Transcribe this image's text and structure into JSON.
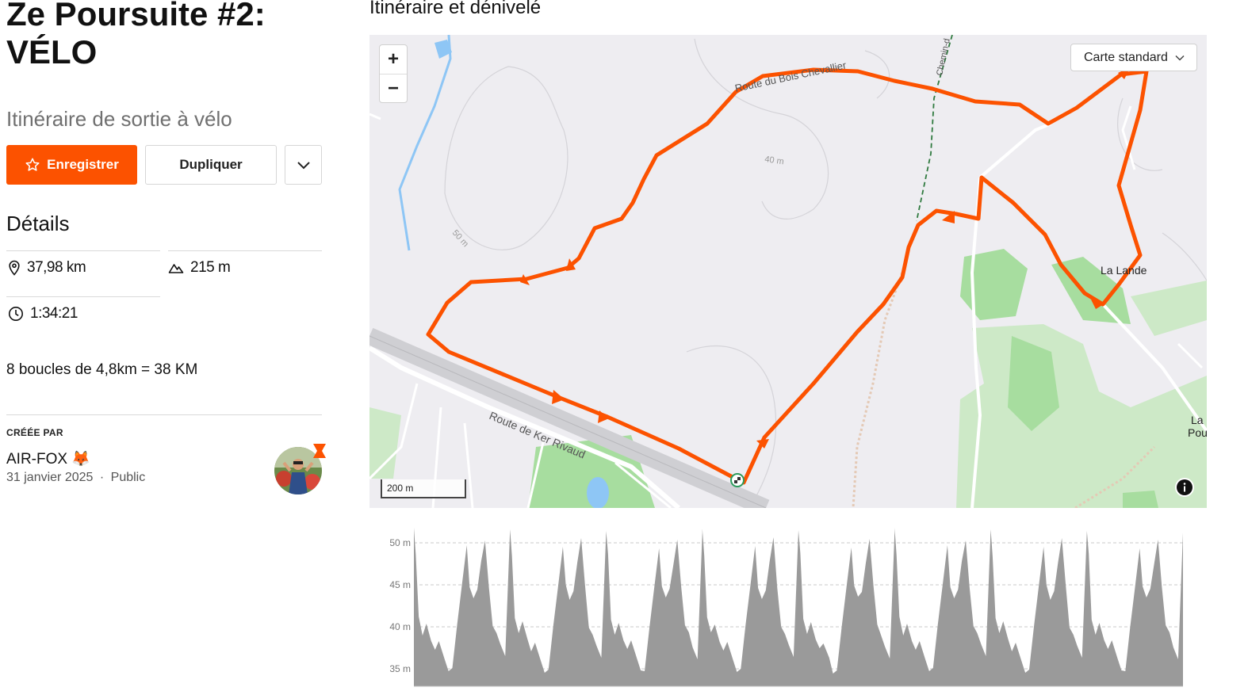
{
  "route": {
    "title": "Ze Poursuite #2: VÉLO",
    "subtitle": "Itinéraire de sortie à vélo",
    "save_label": "Enregistrer",
    "duplicate_label": "Dupliquer",
    "details_title": "Détails",
    "distance": "37,98 km",
    "elevation": "215 m",
    "duration": "1:34:21",
    "description": "8 boucles de 4,8km = 38 KM",
    "created_by_label": "CRÉÉE PAR",
    "author": "AIR-FOX 🦊",
    "date": "31 janvier 2025",
    "separator": "·",
    "visibility": "Public"
  },
  "map": {
    "section_title": "Itinéraire et dénivelé",
    "zoom_in": "+",
    "zoom_out": "−",
    "style_select": "Carte standard",
    "scale": "200 m",
    "labels": {
      "road_bois": "Route du Bois Chevallier",
      "road_ker": "Route de Ker Rivaud",
      "chemin": "Chemin-d",
      "la_lande": "La Lande",
      "la_pou_1": "La",
      "la_pou_2": "Pou",
      "contour_40": "40 m",
      "contour_50": "50 m"
    },
    "colors": {
      "route": "#fc5200",
      "park": "#a7dd9f",
      "water": "#8ec6f5",
      "base": "#eeedf1"
    }
  },
  "elevation_chart": {
    "y_ticks": [
      "50 m",
      "45 m",
      "40 m",
      "35 m"
    ],
    "fill_color": "#9a9a9a"
  }
}
